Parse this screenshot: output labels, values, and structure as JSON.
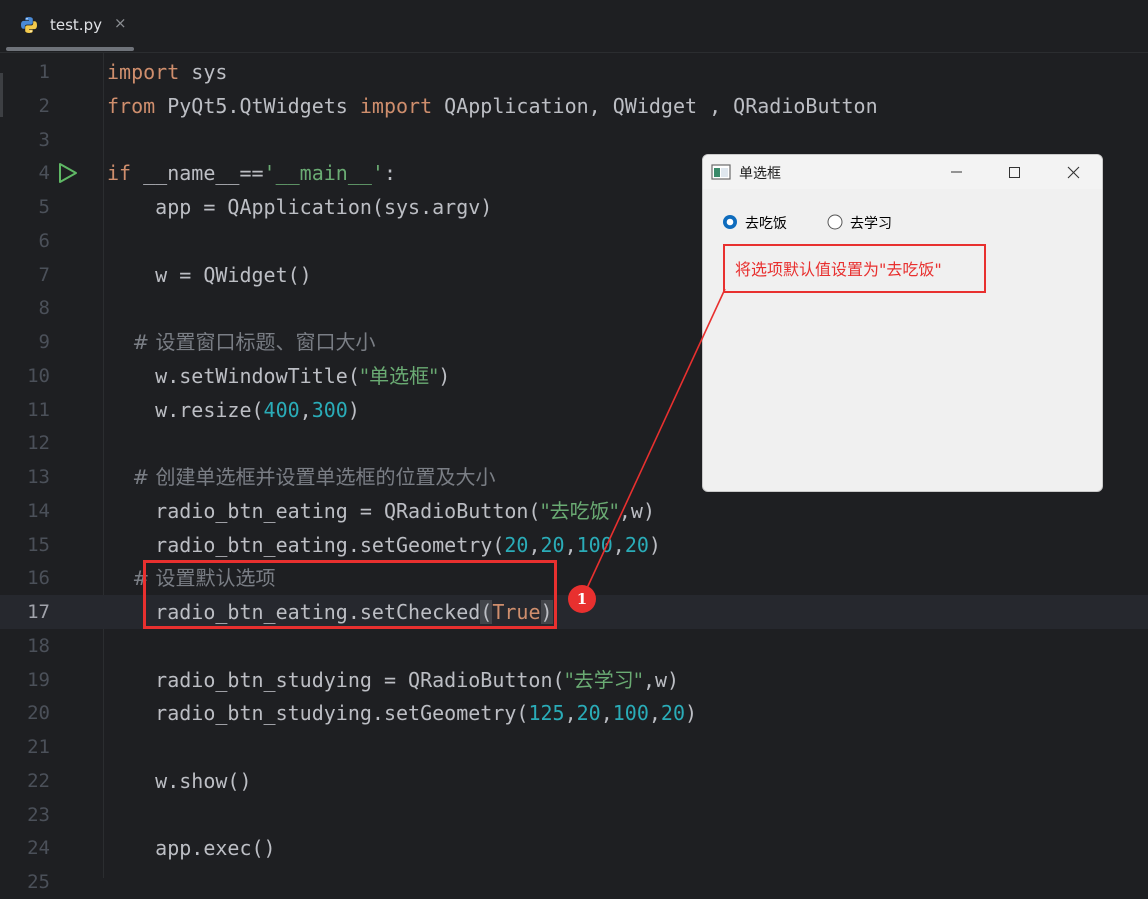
{
  "tab": {
    "filename": "test.py",
    "close_glyph": "×",
    "icon": "python-file-icon"
  },
  "editor": {
    "current_line": 17,
    "lines": [
      {
        "n": "1",
        "tokens": [
          {
            "t": "import",
            "c": "kw"
          },
          {
            "t": " sys",
            "c": ""
          }
        ]
      },
      {
        "n": "2",
        "tokens": [
          {
            "t": "from",
            "c": "kw"
          },
          {
            "t": " PyQt5.QtWidgets ",
            "c": ""
          },
          {
            "t": "import",
            "c": "kw"
          },
          {
            "t": " QApplication, QWidget , QRadioButton",
            "c": ""
          }
        ]
      },
      {
        "n": "3",
        "tokens": []
      },
      {
        "n": "4",
        "tokens": [
          {
            "t": "if",
            "c": "kw"
          },
          {
            "t": " __name__==",
            "c": ""
          },
          {
            "t": "'__main__'",
            "c": "str"
          },
          {
            "t": ":",
            "c": ""
          }
        ],
        "run": true
      },
      {
        "n": "5",
        "tokens": [
          {
            "t": "    app = QApplication(sys.argv)",
            "c": ""
          }
        ]
      },
      {
        "n": "6",
        "tokens": []
      },
      {
        "n": "7",
        "tokens": [
          {
            "t": "    w = QWidget()",
            "c": ""
          }
        ]
      },
      {
        "n": "8",
        "tokens": []
      },
      {
        "n": "9",
        "tokens": [
          {
            "t": "    # 设置窗口标题、窗口大小",
            "c": "cmt"
          }
        ]
      },
      {
        "n": "10",
        "tokens": [
          {
            "t": "    w.setWindowTitle(",
            "c": ""
          },
          {
            "t": "\"单选框\"",
            "c": "str"
          },
          {
            "t": ")",
            "c": ""
          }
        ]
      },
      {
        "n": "11",
        "tokens": [
          {
            "t": "    w.resize(",
            "c": ""
          },
          {
            "t": "400",
            "c": "num"
          },
          {
            "t": ",",
            "c": ""
          },
          {
            "t": "300",
            "c": "num"
          },
          {
            "t": ")",
            "c": ""
          }
        ]
      },
      {
        "n": "12",
        "tokens": []
      },
      {
        "n": "13",
        "tokens": [
          {
            "t": "    # 创建单选框并设置单选框的位置及大小",
            "c": "cmt"
          }
        ]
      },
      {
        "n": "14",
        "tokens": [
          {
            "t": "    radio_btn_eating = QRadioButton(",
            "c": ""
          },
          {
            "t": "\"去吃饭\"",
            "c": "str"
          },
          {
            "t": ",w)",
            "c": ""
          }
        ]
      },
      {
        "n": "15",
        "tokens": [
          {
            "t": "    radio_btn_eating.setGeometry(",
            "c": ""
          },
          {
            "t": "20",
            "c": "num"
          },
          {
            "t": ",",
            "c": ""
          },
          {
            "t": "20",
            "c": "num"
          },
          {
            "t": ",",
            "c": ""
          },
          {
            "t": "100",
            "c": "num"
          },
          {
            "t": ",",
            "c": ""
          },
          {
            "t": "20",
            "c": "num"
          },
          {
            "t": ")",
            "c": ""
          }
        ]
      },
      {
        "n": "16",
        "tokens": [
          {
            "t": "    # 设置默认选项",
            "c": "cmt"
          }
        ]
      },
      {
        "n": "17",
        "tokens": [
          {
            "t": "    radio_btn_eating.setChecked",
            "c": ""
          },
          {
            "t": "(",
            "c": "brk"
          },
          {
            "t": "True",
            "c": "kw"
          },
          {
            "t": ")",
            "c": "brk"
          }
        ]
      },
      {
        "n": "18",
        "tokens": []
      },
      {
        "n": "19",
        "tokens": [
          {
            "t": "    radio_btn_studying = QRadioButton(",
            "c": ""
          },
          {
            "t": "\"去学习\"",
            "c": "str"
          },
          {
            "t": ",w)",
            "c": ""
          }
        ]
      },
      {
        "n": "20",
        "tokens": [
          {
            "t": "    radio_btn_studying.setGeometry(",
            "c": ""
          },
          {
            "t": "125",
            "c": "num"
          },
          {
            "t": ",",
            "c": ""
          },
          {
            "t": "20",
            "c": "num"
          },
          {
            "t": ",",
            "c": ""
          },
          {
            "t": "100",
            "c": "num"
          },
          {
            "t": ",",
            "c": ""
          },
          {
            "t": "20",
            "c": "num"
          },
          {
            "t": ")",
            "c": ""
          }
        ]
      },
      {
        "n": "21",
        "tokens": []
      },
      {
        "n": "22",
        "tokens": [
          {
            "t": "    w.show()",
            "c": ""
          }
        ]
      },
      {
        "n": "23",
        "tokens": []
      },
      {
        "n": "24",
        "tokens": [
          {
            "t": "    app.exec()",
            "c": ""
          }
        ]
      },
      {
        "n": "25",
        "tokens": []
      }
    ]
  },
  "qt_window": {
    "title": "单选框",
    "minimize_icon": "minimize-icon",
    "maximize_icon": "maximize-icon",
    "close_icon": "close-icon",
    "radio_eating": {
      "label": "去吃饭",
      "checked": true
    },
    "radio_studying": {
      "label": "去学习",
      "checked": false
    }
  },
  "annotation": {
    "callout_text": "将选项默认值设置为\"去吃饭\"",
    "marker_number": "1",
    "color": "#e8302f"
  }
}
